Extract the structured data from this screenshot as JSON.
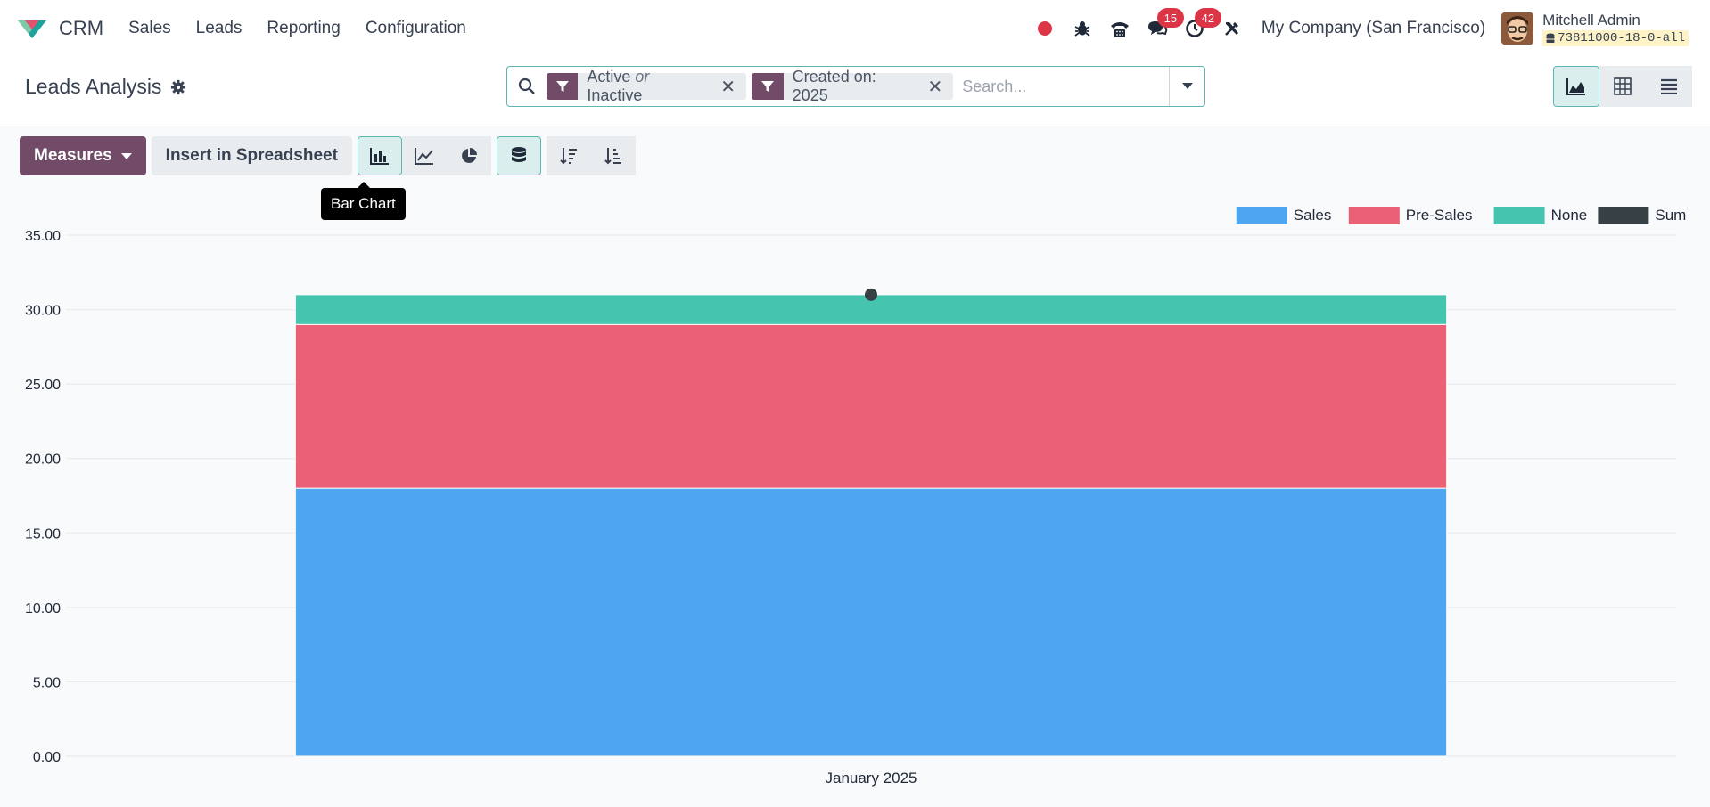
{
  "navbar": {
    "app_name": "CRM",
    "menu": [
      "Sales",
      "Leads",
      "Reporting",
      "Configuration"
    ],
    "messages_count": "15",
    "activities_count": "42",
    "company": "My Company (San Francisco)",
    "user_name": "Mitchell Admin",
    "database": "73811000-18-0-all",
    "icons": [
      "recording-dot",
      "bug-icon",
      "phone-icon",
      "chat-icon",
      "clock-icon",
      "tools-icon"
    ]
  },
  "control": {
    "title": "Leads Analysis",
    "facets": [
      {
        "part1": "Active",
        "or": "or",
        "part2": "Inactive"
      },
      {
        "label": "Created on: 2025"
      }
    ],
    "search_placeholder": "Search..."
  },
  "toolbar": {
    "measures_label": "Measures",
    "spreadsheet_label": "Insert in Spreadsheet",
    "tooltip": "Bar Chart"
  },
  "colors": {
    "primary": "#714b67",
    "accent": "#5fb6b0",
    "sales": "#4ea6f1",
    "presales": "#ea6074",
    "none": "#45c4b0",
    "sum": "#374045"
  },
  "chart_data": {
    "type": "bar",
    "stacked": true,
    "categories": [
      "January 2025"
    ],
    "series": [
      {
        "name": "Sales",
        "values": [
          18
        ]
      },
      {
        "name": "Pre-Sales",
        "values": [
          11
        ]
      },
      {
        "name": "None",
        "values": [
          2
        ]
      }
    ],
    "sum_series": {
      "name": "Sum",
      "values": [
        31
      ]
    },
    "ylim": [
      0,
      35
    ],
    "yticks": [
      "0.00",
      "5.00",
      "10.00",
      "15.00",
      "20.00",
      "25.00",
      "30.00",
      "35.00"
    ],
    "grid": true,
    "legend": "top-right"
  }
}
